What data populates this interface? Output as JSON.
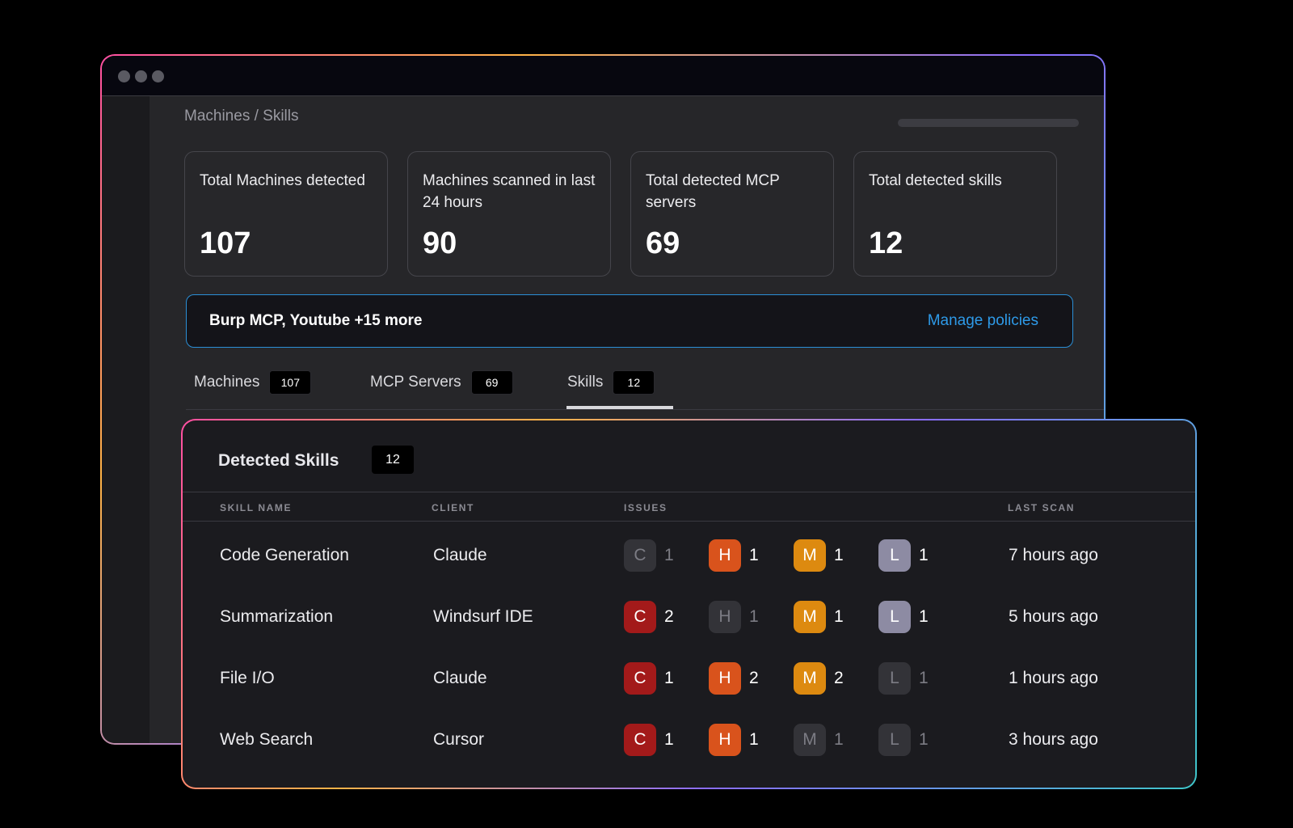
{
  "breadcrumb": "Machines / Skills",
  "stats": [
    {
      "label": "Total Machines detected",
      "value": "107"
    },
    {
      "label": "Machines scanned in last 24 hours",
      "value": "90"
    },
    {
      "label": "Total detected MCP servers",
      "value": "69"
    },
    {
      "label": "Total detected skills",
      "value": "12"
    }
  ],
  "banner": {
    "text": "Burp MCP, Youtube +15 more",
    "link": "Manage policies"
  },
  "tabs": [
    {
      "label": "Machines",
      "count": "107"
    },
    {
      "label": "MCP Servers",
      "count": "69"
    },
    {
      "label": "Skills",
      "count": "12",
      "active": true
    }
  ],
  "panel": {
    "title": "Detected Skills",
    "count": "12",
    "columns": {
      "skill": "SKILL NAME",
      "client": "CLIENT",
      "issues": "ISSUES",
      "last_scan": "LAST SCAN"
    },
    "rows": [
      {
        "skill": "Code Generation",
        "client": "Claude",
        "issues": {
          "C": {
            "letter": "C",
            "count": "1",
            "active": false
          },
          "H": {
            "letter": "H",
            "count": "1",
            "active": true
          },
          "M": {
            "letter": "M",
            "count": "1",
            "active": true
          },
          "L": {
            "letter": "L",
            "count": "1",
            "active": true
          }
        },
        "last_scan": "7 hours ago"
      },
      {
        "skill": "Summarization",
        "client": "Windsurf IDE",
        "issues": {
          "C": {
            "letter": "C",
            "count": "2",
            "active": true
          },
          "H": {
            "letter": "H",
            "count": "1",
            "active": false
          },
          "M": {
            "letter": "M",
            "count": "1",
            "active": true
          },
          "L": {
            "letter": "L",
            "count": "1",
            "active": true
          }
        },
        "last_scan": "5 hours ago"
      },
      {
        "skill": "File I/O",
        "client": "Claude",
        "issues": {
          "C": {
            "letter": "C",
            "count": "1",
            "active": true
          },
          "H": {
            "letter": "H",
            "count": "2",
            "active": true
          },
          "M": {
            "letter": "M",
            "count": "2",
            "active": true
          },
          "L": {
            "letter": "L",
            "count": "1",
            "active": false
          }
        },
        "last_scan": "1  hours ago"
      },
      {
        "skill": "Web Search",
        "client": "Cursor",
        "issues": {
          "C": {
            "letter": "C",
            "count": "1",
            "active": true
          },
          "H": {
            "letter": "H",
            "count": "1",
            "active": true
          },
          "M": {
            "letter": "M",
            "count": "1",
            "active": false
          },
          "L": {
            "letter": "L",
            "count": "1",
            "active": false
          }
        },
        "last_scan": "3 hours ago"
      }
    ]
  },
  "colors": {
    "critical": "#a31a1a",
    "high": "#d9531c",
    "medium": "#dd8a10",
    "low": "#8d8ba3",
    "accent": "#2e9ae8"
  }
}
